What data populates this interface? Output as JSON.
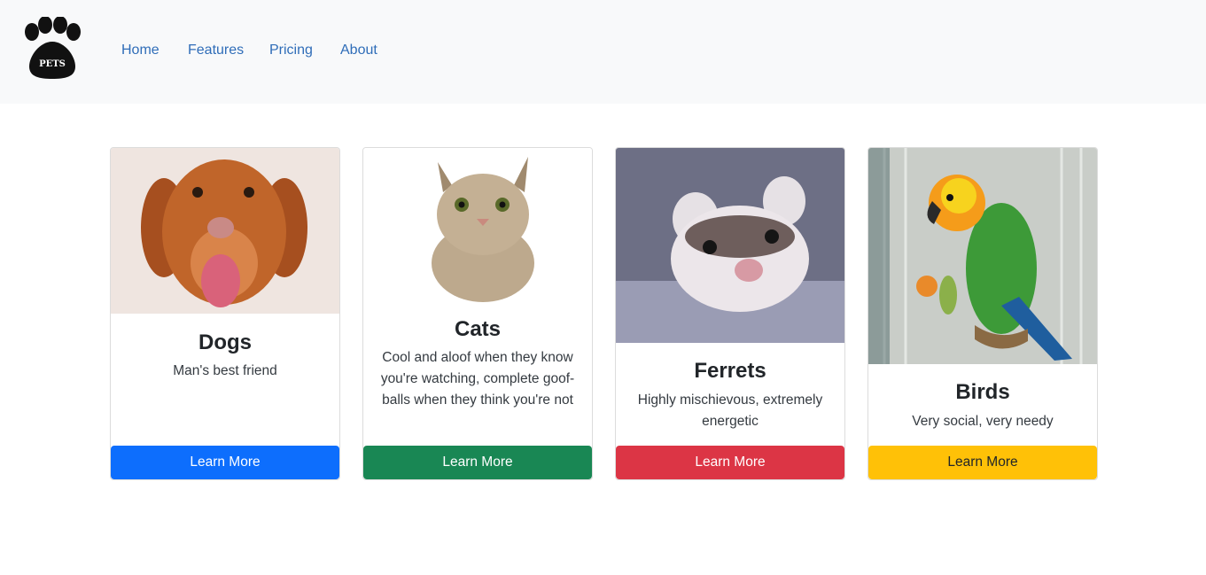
{
  "nav": {
    "logo_text": "PETS",
    "links": [
      "Home",
      "Features",
      "Pricing",
      "About"
    ]
  },
  "colors": {
    "nav_bg": "#f8f9fa",
    "link": "#2f6db8",
    "primary": "#0d6efd",
    "success": "#198754",
    "danger": "#dc3545",
    "warning": "#ffc107"
  },
  "cards": [
    {
      "image": "dog-photo",
      "title": "Dogs",
      "text": "Man's best friend",
      "button": "Learn More"
    },
    {
      "image": "cat-photo",
      "title": "Cats",
      "text": "Cool and aloof when they know you're watching, complete goof-balls when they think you're not",
      "button": "Learn More"
    },
    {
      "image": "ferret-photo",
      "title": "Ferrets",
      "text": "Highly mischievous, extremely energetic",
      "button": "Learn More"
    },
    {
      "image": "parrot-photo",
      "title": "Birds",
      "text": "Very social, very needy",
      "button": "Learn More"
    }
  ]
}
